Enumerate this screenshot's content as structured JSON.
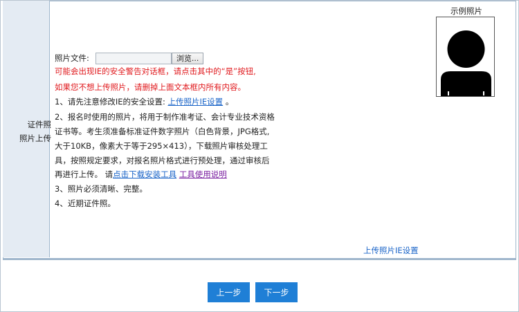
{
  "form": {
    "row_label": "证件照照片上传",
    "row_label_line1": "证件照",
    "row_label_line2": "照片上传",
    "file": {
      "label": "照片文件:",
      "value": "",
      "browse_label": "浏览..."
    },
    "warning_line1": "可能会出现IE的安全警告对话框，请点击其中的“是”按钮,",
    "warning_line2": "如果您不想上传照片，请删掉上面文本框内所有内容。",
    "item1_prefix": "1、请先注意修改IE的安全设置: ",
    "item1_link": "上传照片IE设置",
    "item1_suffix": " 。",
    "item2_line1": "2、报名时使用的照片，将用于制作准考证、会计专业技术资格",
    "item2_line2": "证书等。考生须准备标准证件数字照片（白色背景，JPG格式,",
    "item2_line3": "大于10KB，像素大于等于295×413），下载照片审核处理工",
    "item2_line4": "具，按照规定要求，对报名照片格式进行预处理，通过审核后",
    "item2_line5_prefix": "再进行上传。 请",
    "item2_link_download": "点击下载安装工具",
    "item2_link_usage": "工具使用说明",
    "item3": "3、照片必须清晰、完整。",
    "item4": "4、近期证件照。",
    "sample_title": "示例照片",
    "bottom_link": "上传照片IE设置"
  },
  "buttons": {
    "prev_label": "上一步",
    "next_label": "下一步",
    "color": "#1f7fd6"
  },
  "colors": {
    "warning": "#e0191d",
    "link": "#1a64c8",
    "visited_link": "#7a1fa0",
    "label_bg": "#e4ebf3"
  }
}
